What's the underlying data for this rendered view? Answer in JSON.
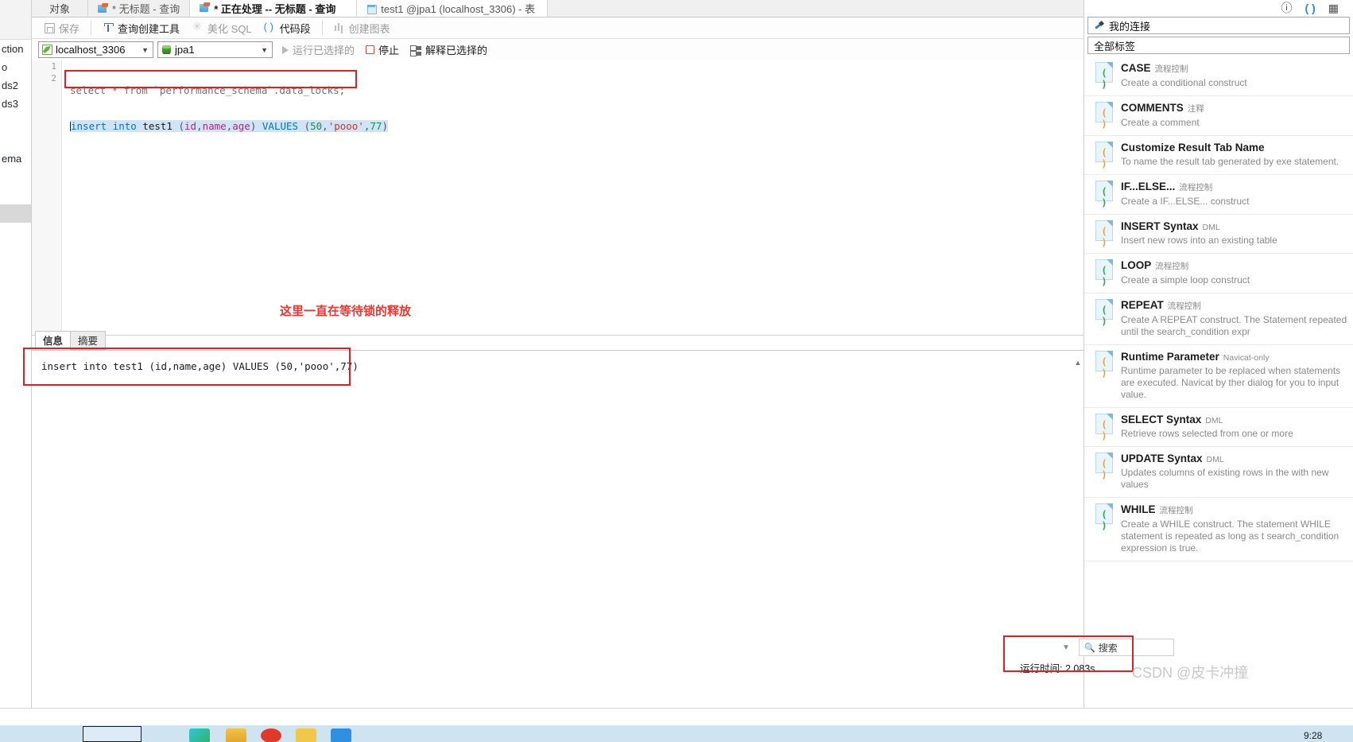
{
  "window": {
    "tabs": [
      {
        "label": "对象",
        "icon": "none",
        "state": "inactive"
      },
      {
        "label": "* 无标题 - 查询",
        "icon": "query-icon",
        "state": "inactive"
      },
      {
        "label": "* 正在处理 -- 无标题 - 查询",
        "icon": "query-icon",
        "state": "active"
      },
      {
        "label": "test1 @jpa1 (localhost_3306) - 表",
        "icon": "table-icon",
        "state": "selected"
      }
    ]
  },
  "toolbar": {
    "save_label": "保存",
    "query_builder_label": "查询创建工具",
    "beautify_label": "美化 SQL",
    "snippet_label": "代码段",
    "create_chart_label": "创建图表"
  },
  "connbar": {
    "connection_value": "localhost_3306",
    "database_value": "jpa1",
    "run_selected_label": "运行已选择的",
    "stop_label": "停止",
    "explain_selected_label": "解释已选择的"
  },
  "editor": {
    "line_numbers": [
      "1",
      "2"
    ],
    "line1": {
      "kw1": "select",
      "star": " * ",
      "kw2": "from",
      "rest": " `performance_schema`.data_locks;"
    },
    "line2": {
      "kw_insert": "insert into",
      "table": " test1 ",
      "paren_open": "(",
      "col1": "id",
      "comma1": ",",
      "col2": "name",
      "comma2": ",",
      "col3": "age",
      "paren_close": ") ",
      "kw_values": "VALUES",
      "vparen_open": " (",
      "v1": "50",
      "vcomma1": ",",
      "v2": "'pooo'",
      "vcomma2": ",",
      "v3": "77",
      "vparen_close": ")"
    },
    "annotation": "这里一直在等待锁的释放"
  },
  "results": {
    "tabs": [
      {
        "label": "信息",
        "active": true
      },
      {
        "label": "摘要",
        "active": false
      }
    ],
    "message": "insert into test1 (id,name,age) VALUES (50,'pooo',77)"
  },
  "right_panel": {
    "header_label": "我的连接",
    "filter_label": "全部标签",
    "icons": [
      "info-icon",
      "snippet-icon",
      "table-grid-icon"
    ],
    "snippets": [
      {
        "title": "CASE",
        "category": "流程控制",
        "desc": "Create a conditional construct",
        "paren_color": "green"
      },
      {
        "title": "COMMENTS",
        "category": "注释",
        "desc": "Create a comment",
        "paren_color": "orange"
      },
      {
        "title": "Customize Result Tab Name",
        "category": "",
        "desc": "To name the result tab generated by exe statement.",
        "paren_color": "orange"
      },
      {
        "title": "IF...ELSE...",
        "category": "流程控制",
        "desc": "Create a IF...ELSE... construct",
        "paren_color": "green"
      },
      {
        "title": "INSERT Syntax",
        "category": "DML",
        "desc": "Insert new rows into an existing table",
        "paren_color": "orange"
      },
      {
        "title": "LOOP",
        "category": "流程控制",
        "desc": "Create a simple loop construct",
        "paren_color": "green"
      },
      {
        "title": "REPEAT",
        "category": "流程控制",
        "desc": "Create A REPEAT construct. The Statement repeated until the search_condition expr",
        "paren_color": "green"
      },
      {
        "title": "Runtime Parameter",
        "category": "Navicat-only",
        "desc": "Runtime parameter to be replaced when statements are executed. Navicat by ther dialog for you to input value.",
        "paren_color": "orange"
      },
      {
        "title": "SELECT Syntax",
        "category": "DML",
        "desc": "Retrieve rows selected from one or more",
        "paren_color": "orange"
      },
      {
        "title": "UPDATE Syntax",
        "category": "DML",
        "desc": "Updates columns of existing rows in the with new values",
        "paren_color": "orange"
      },
      {
        "title": "WHILE",
        "category": "流程控制",
        "desc": "Create a WHILE construct. The statement WHILE statement is repeated as long as t search_condition expression is true.",
        "paren_color": "green"
      }
    ]
  },
  "left_rail": {
    "items": [
      "ction",
      "o",
      "ds2",
      "ds3",
      "",
      "ema"
    ]
  },
  "status": {
    "search_placeholder": "搜索",
    "runtime_label": "运行时间: 2.083s",
    "watermark": "CSDN @皮卡冲撞",
    "clock": "9:28"
  },
  "colors": {
    "accent_red": "#e02020",
    "keyword_blue": "#0b6fc4",
    "string_red": "#c0392b",
    "number_green": "#1f8a4c",
    "selection_blue": "#cfe4f7"
  }
}
